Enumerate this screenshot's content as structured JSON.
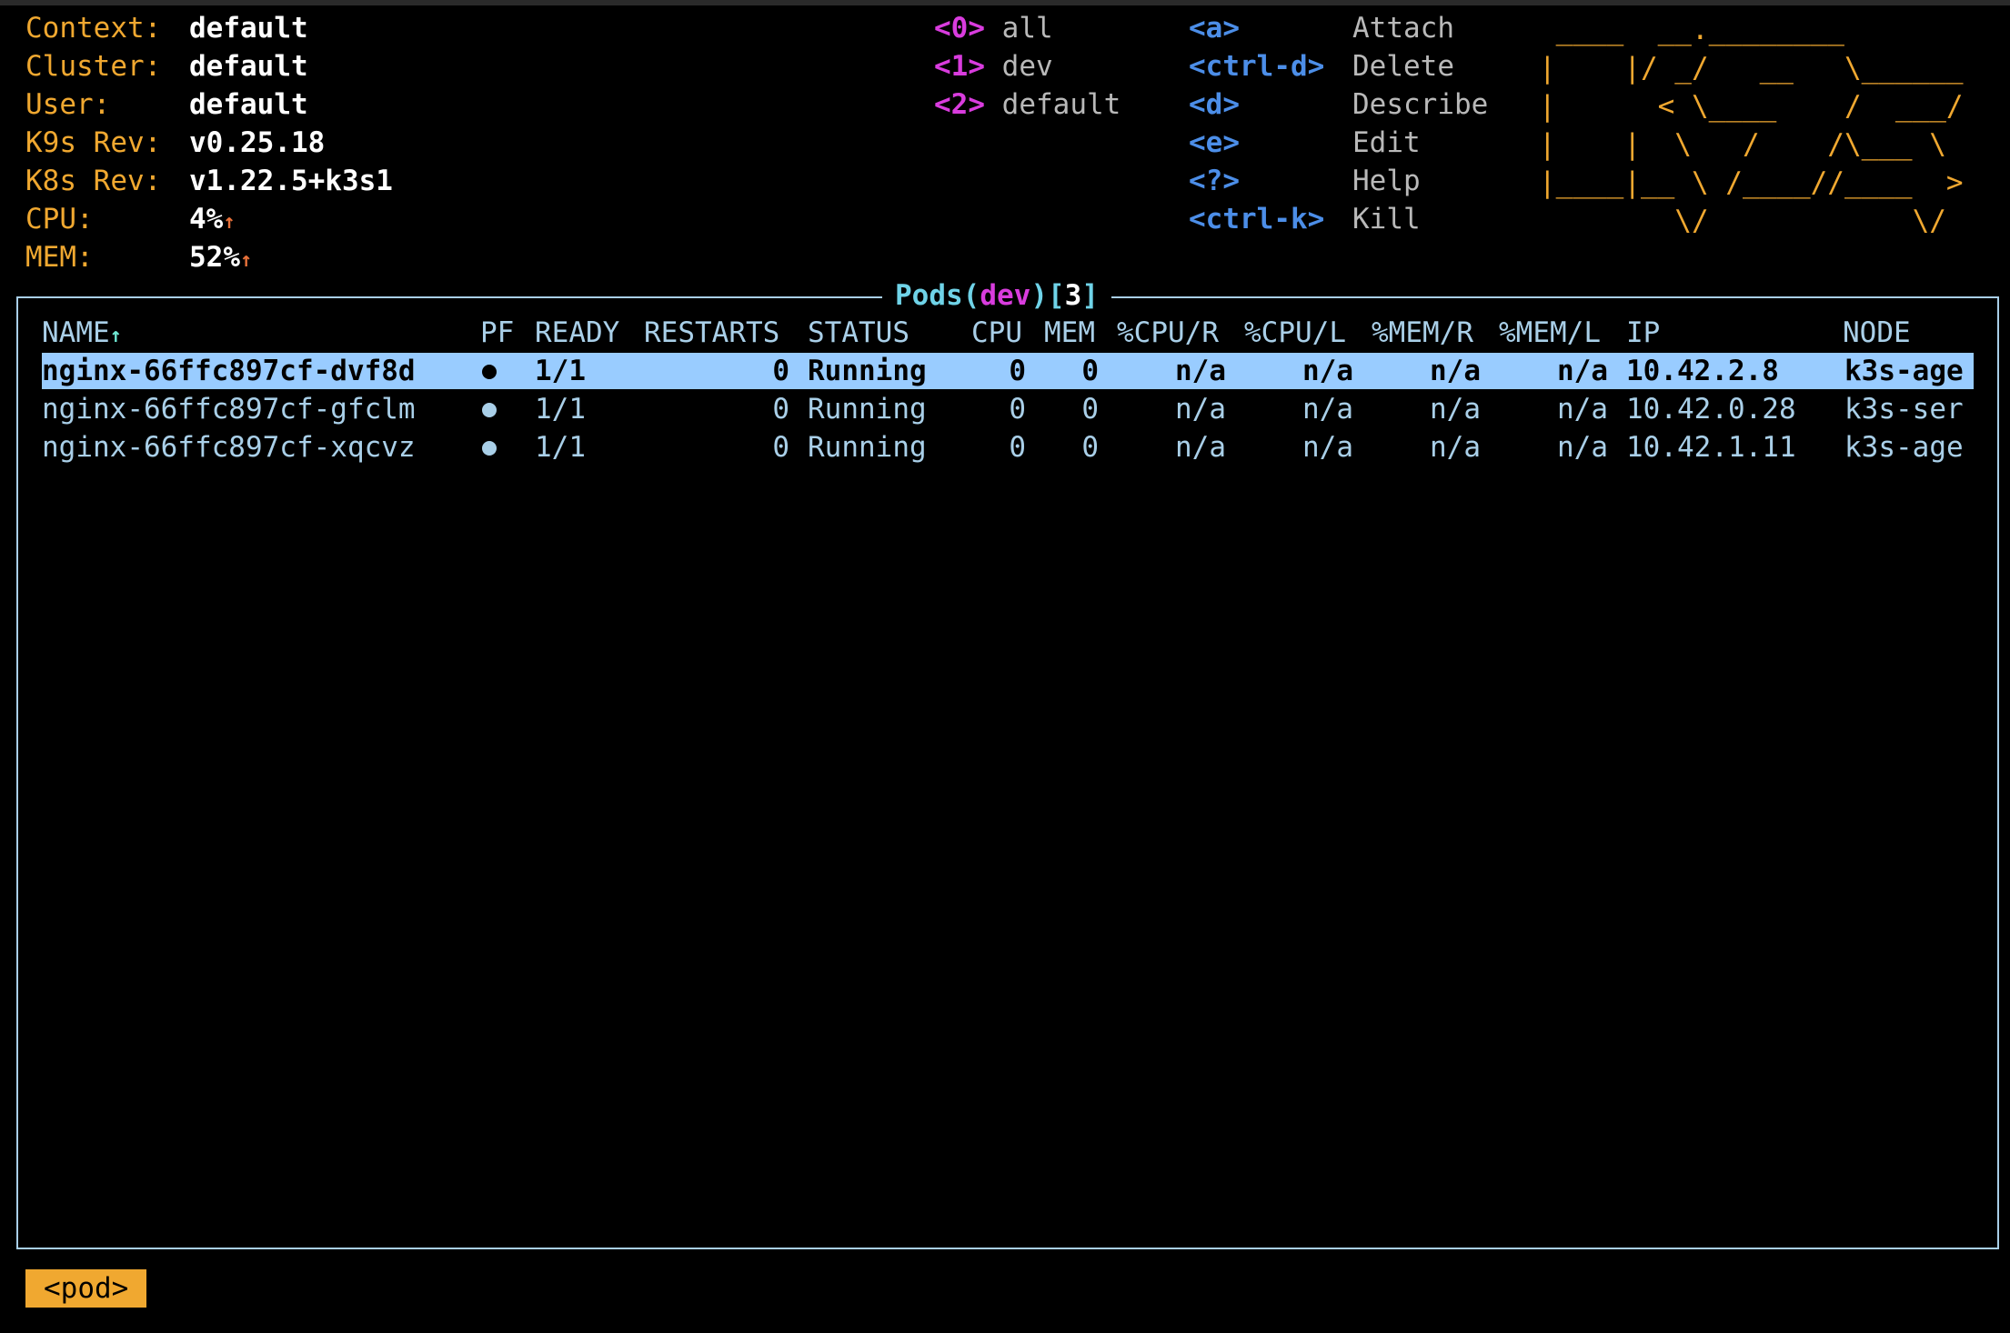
{
  "info": {
    "context_label": "Context:",
    "context_value": "default",
    "cluster_label": "Cluster:",
    "cluster_value": "default",
    "user_label": "User:",
    "user_value": "default",
    "k9s_label": "K9s Rev:",
    "k9s_value": "v0.25.18",
    "k8s_label": "K8s Rev:",
    "k8s_value": "v1.22.5+k3s1",
    "cpu_label": "CPU:",
    "cpu_value": "4%",
    "mem_label": "MEM:",
    "mem_value": "52%",
    "trend_arrow": "↑"
  },
  "namespaces": [
    {
      "key": "<0>",
      "name": "all"
    },
    {
      "key": "<1>",
      "name": "dev"
    },
    {
      "key": "<2>",
      "name": "default"
    }
  ],
  "hotkeys": [
    {
      "key": "<a>",
      "name": "Attach"
    },
    {
      "key": "<ctrl-d>",
      "name": "Delete"
    },
    {
      "key": "<d>",
      "name": "Describe"
    },
    {
      "key": "<e>",
      "name": "Edit"
    },
    {
      "key": "<?>",
      "name": "Help"
    },
    {
      "key": "<ctrl-k>",
      "name": "Kill"
    }
  ],
  "logo_ascii": " ____  __.________\n|    |/ _/   __   \\______\n|      < \\____    /  ___/\n|    |  \\   /    /\\___ \\\n|____|__ \\ /____//____  >\n        \\/            \\/",
  "view": {
    "resource": "Pods",
    "namespace": "dev",
    "count": "3",
    "open_paren": "(",
    "close_paren": ")",
    "open_bracket": "[",
    "close_bracket": "]"
  },
  "table": {
    "headers": {
      "name": "NAME",
      "sort_arrow": "↑",
      "pf": "PF",
      "ready": "READY",
      "restarts": "RESTARTS",
      "status": "STATUS",
      "cpu": "CPU",
      "mem": "MEM",
      "cpu_r": "%CPU/R",
      "cpu_l": "%CPU/L",
      "mem_r": "%MEM/R",
      "mem_l": "%MEM/L",
      "ip": "IP",
      "node": "NODE"
    },
    "rows": [
      {
        "name": "nginx-66ffc897cf-dvf8d",
        "ready": "1/1",
        "restarts": "0",
        "status": "Running",
        "cpu": "0",
        "mem": "0",
        "cpu_r": "n/a",
        "cpu_l": "n/a",
        "mem_r": "n/a",
        "mem_l": "n/a",
        "ip": "10.42.2.8",
        "node": "k3s-age"
      },
      {
        "name": "nginx-66ffc897cf-gfclm",
        "ready": "1/1",
        "restarts": "0",
        "status": "Running",
        "cpu": "0",
        "mem": "0",
        "cpu_r": "n/a",
        "cpu_l": "n/a",
        "mem_r": "n/a",
        "mem_l": "n/a",
        "ip": "10.42.0.28",
        "node": "k3s-ser"
      },
      {
        "name": "nginx-66ffc897cf-xqcvz",
        "ready": "1/1",
        "restarts": "0",
        "status": "Running",
        "cpu": "0",
        "mem": "0",
        "cpu_r": "n/a",
        "cpu_l": "n/a",
        "mem_r": "n/a",
        "mem_l": "n/a",
        "ip": "10.42.1.11",
        "node": "k3s-age"
      }
    ]
  },
  "footer": {
    "crumb": "<pod>"
  }
}
